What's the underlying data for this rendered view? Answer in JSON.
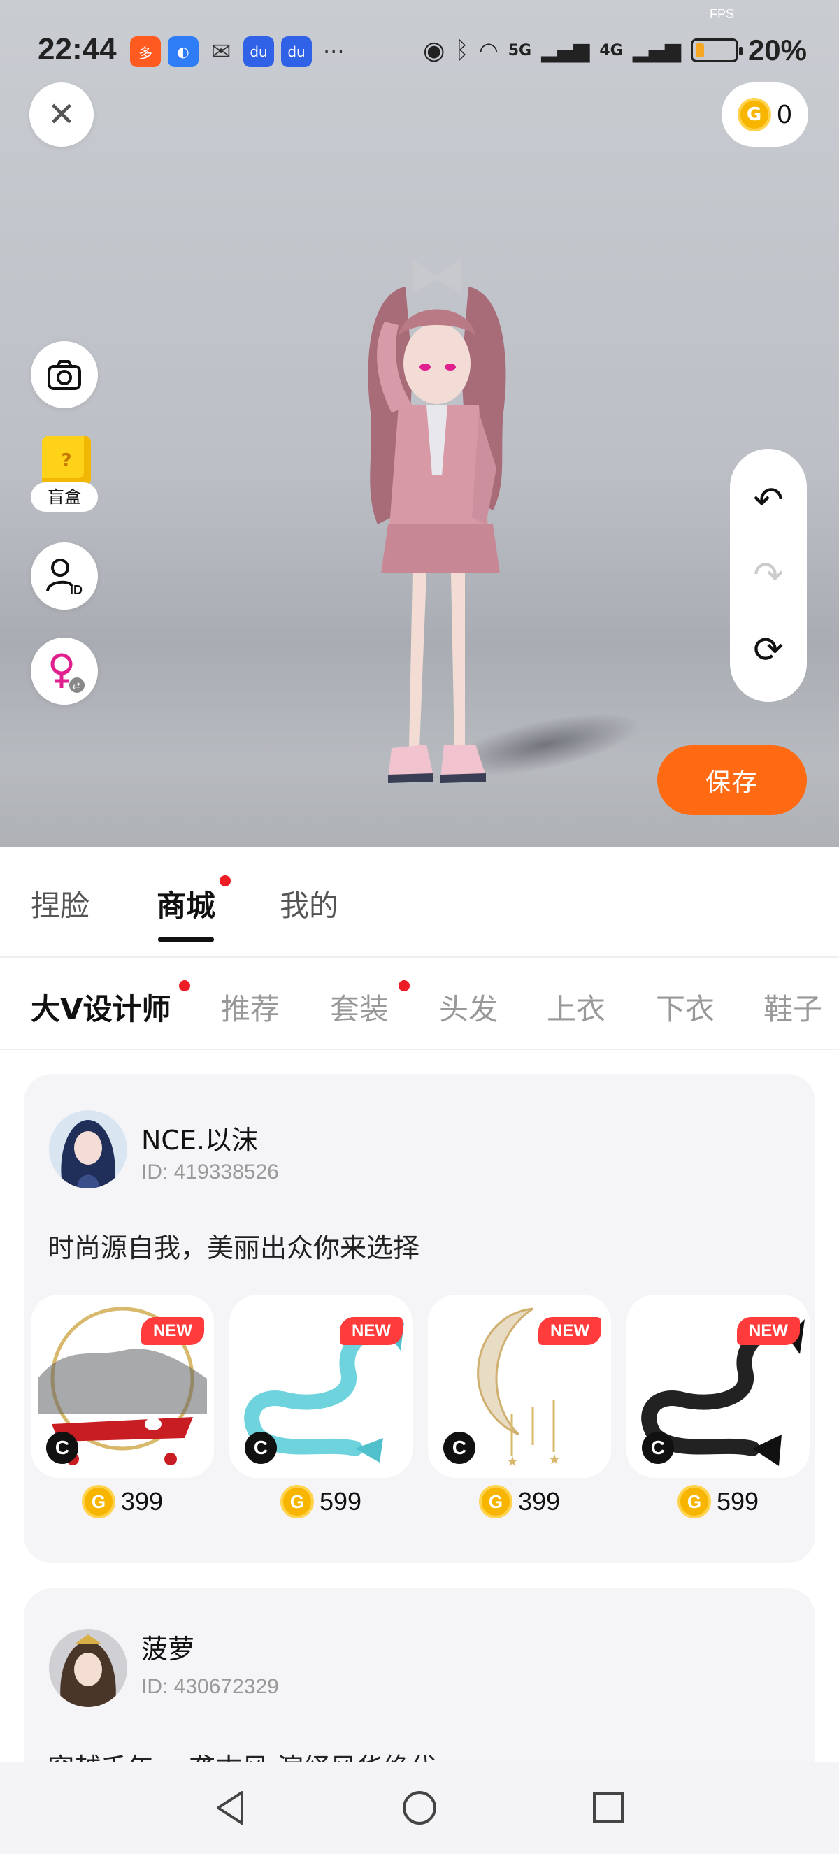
{
  "status_bar": {
    "time": "22:44",
    "fps_label": "FPS",
    "signal_5g": "5G",
    "signal_4g": "4G",
    "battery_percent": "20%",
    "more_indicator": "···"
  },
  "top_bar": {
    "coin_balance": "0"
  },
  "left_tools": {
    "blind_box_label": "盲盒"
  },
  "actions": {
    "save_label": "保存"
  },
  "main_tabs": [
    {
      "label": "捏脸"
    },
    {
      "label": "商城"
    },
    {
      "label": "我的"
    }
  ],
  "category_tabs": [
    {
      "label": "大V设计师"
    },
    {
      "label": "推荐"
    },
    {
      "label": "套装"
    },
    {
      "label": "头发"
    },
    {
      "label": "上衣"
    },
    {
      "label": "下衣"
    },
    {
      "label": "鞋子"
    }
  ],
  "designers": [
    {
      "name": "NCE.以沫",
      "id_text": "ID: 419338526",
      "description": "时尚源自我，美丽出众你来选择",
      "products": [
        {
          "badge": "NEW",
          "creator_mark": "C",
          "price": "399"
        },
        {
          "badge": "NEW",
          "creator_mark": "C",
          "price": "599"
        },
        {
          "badge": "NEW",
          "creator_mark": "C",
          "price": "399"
        },
        {
          "badge": "NEW",
          "creator_mark": "C",
          "price": "599"
        }
      ]
    },
    {
      "name": "菠萝",
      "id_text": "ID: 430672329",
      "description": "穿越千年 一袭古风 演绎风华绝代"
    }
  ],
  "colors": {
    "accent_orange": "#ff6a13",
    "badge_red": "#ff3b3b",
    "coin_gold": "#f7b500",
    "notification_dot": "#ee1c25"
  }
}
